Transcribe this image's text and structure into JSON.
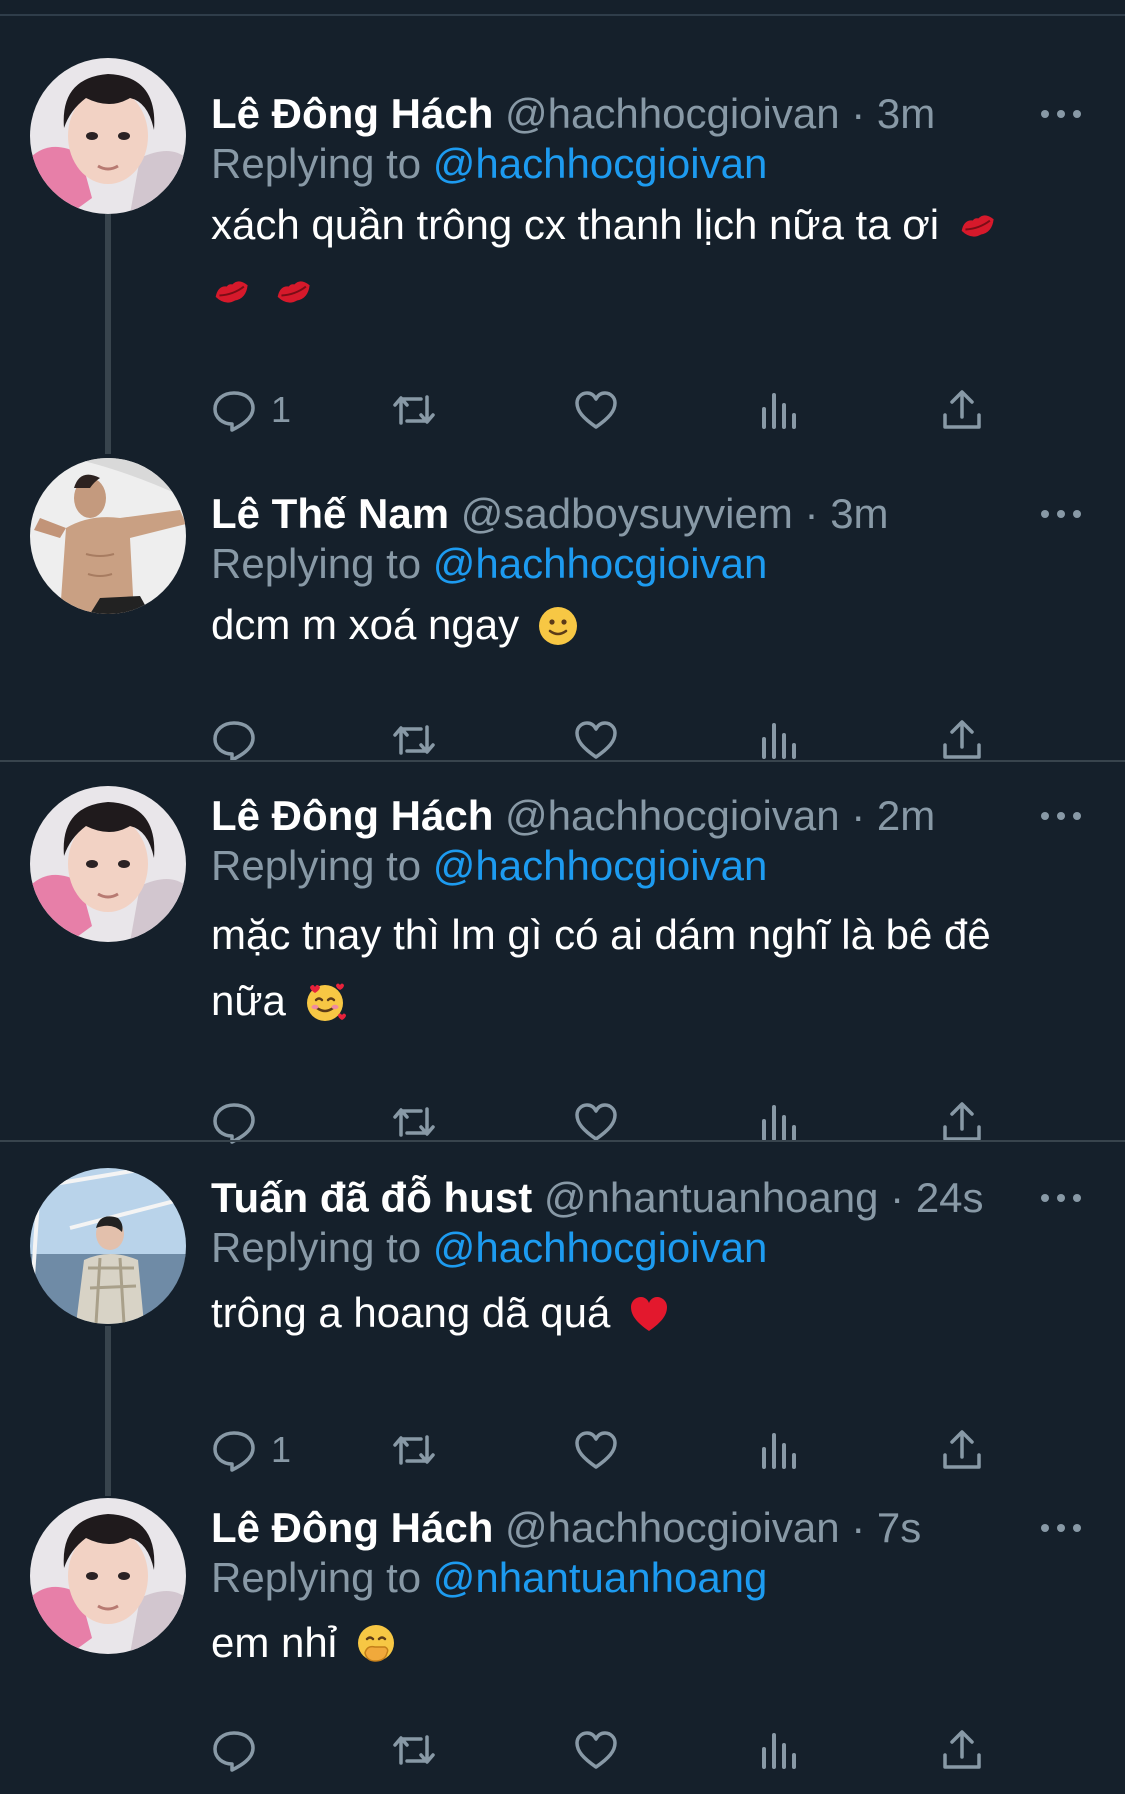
{
  "colors": {
    "background": "#15202b",
    "secondary_text": "#8899a6",
    "link": "#1d9bf0",
    "divider": "#38444d"
  },
  "tweets": [
    {
      "name": "Lê Đông Hách",
      "handle": "@hachhocgioivan",
      "separator": "·",
      "time": "3m",
      "replying_label": "Replying to",
      "replying_to": "@hachhocgioivan",
      "text": "xách quần trông cx thanh lịch nữa ta ơi",
      "emojis": [
        "kiss-mark",
        "kiss-mark",
        "kiss-mark"
      ],
      "reply_count": "1",
      "avatar": "avatar-pink-hoodie"
    },
    {
      "name": "Lê Thế Nam",
      "handle": "@sadboysuyviem",
      "separator": "·",
      "time": "3m",
      "replying_label": "Replying to",
      "replying_to": "@hachhocgioivan",
      "text": "dcm m xoá ngay",
      "emojis": [
        "slightly-smiling-face"
      ],
      "reply_count": "",
      "avatar": "avatar-shirtless"
    },
    {
      "name": "Lê Đông Hách",
      "handle": "@hachhocgioivan",
      "separator": "·",
      "time": "2m",
      "replying_label": "Replying to",
      "replying_to": "@hachhocgioivan",
      "text_line1": "mặc tnay thì lm gì có ai dám nghĩ là bê đê",
      "text_line2": "nữa",
      "emojis": [
        "smiling-face-with-hearts"
      ],
      "reply_count": "",
      "avatar": "avatar-pink-hoodie"
    },
    {
      "name": "Tuấn đã đỗ hust",
      "handle": "@nhantuanhoang",
      "separator": "·",
      "time": "24s",
      "replying_label": "Replying to",
      "replying_to": "@hachhocgioivan",
      "text": "trông a hoang dã quá",
      "emojis": [
        "red-heart"
      ],
      "reply_count": "1",
      "avatar": "avatar-sea"
    },
    {
      "name": "Lê Đông Hách",
      "handle": "@hachhocgioivan",
      "separator": "·",
      "time": "7s",
      "replying_label": "Replying to",
      "replying_to": "@nhantuanhoang",
      "text": "em nhỉ",
      "emojis": [
        "face-with-hand-over-mouth"
      ],
      "reply_count": "",
      "avatar": "avatar-pink-hoodie"
    }
  ],
  "action_icons": [
    "reply-icon",
    "retweet-icon",
    "like-icon",
    "analytics-icon",
    "share-icon"
  ]
}
